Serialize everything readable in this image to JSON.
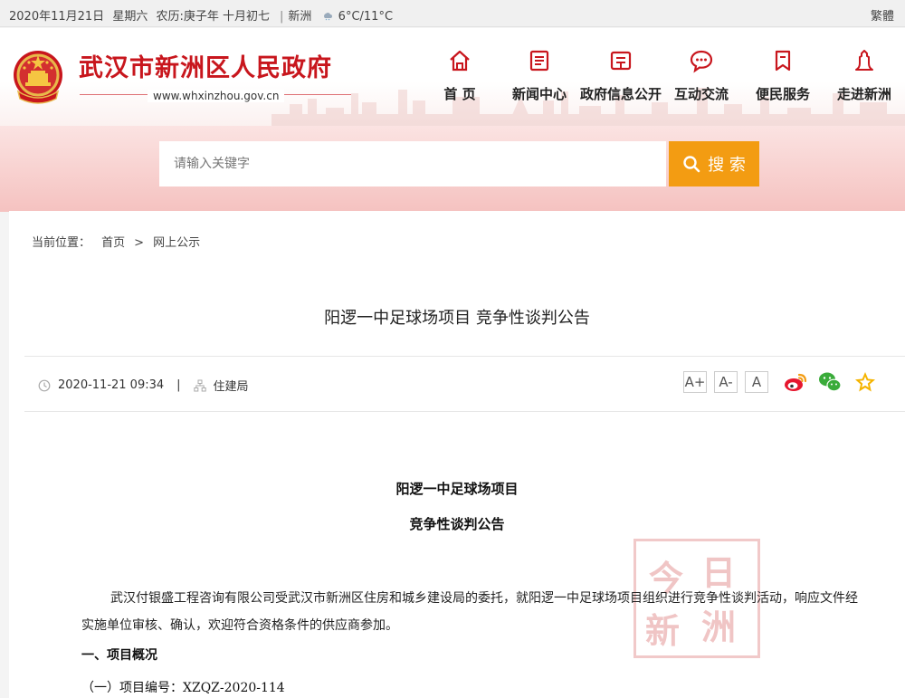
{
  "topbar": {
    "date": "2020年11月21日",
    "weekday": "星期六",
    "lunar": "农历:庚子年 十月初七",
    "city": "新洲",
    "temperature": "6°C/11°C",
    "traditional_label": "繁體"
  },
  "header": {
    "site_title": "武汉市新洲区人民政府",
    "site_url": "www.whxinzhou.gov.cn",
    "nav": [
      {
        "label": "首 页",
        "icon": "home-icon"
      },
      {
        "label": "新闻中心",
        "icon": "news-icon"
      },
      {
        "label": "政府信息公开",
        "icon": "info-icon"
      },
      {
        "label": "互动交流",
        "icon": "chat-icon"
      },
      {
        "label": "便民服务",
        "icon": "bookmark-icon"
      },
      {
        "label": "走进新洲",
        "icon": "landmark-icon"
      }
    ]
  },
  "search": {
    "placeholder": "请输入关键字",
    "button_label": "搜 索"
  },
  "breadcrumb": {
    "prefix": "当前位置：",
    "home": "首页",
    "separator": ">",
    "current": "网上公示"
  },
  "article": {
    "title": "阳逻一中足球场项目 竞争性谈判公告",
    "datetime": "2020-11-21 09:34",
    "meta_sep": "|",
    "source": "住建局",
    "font_sizes": [
      "A+",
      "A-",
      "A"
    ],
    "share": [
      "weibo-icon",
      "wechat-icon",
      "favorite-icon"
    ],
    "doc_title_1": "阳逻一中足球场项目",
    "doc_title_2": "竞争性谈判公告",
    "paragraph": "武汉付银盛工程咨询有限公司受武汉市新洲区住房和城乡建设局的委托，就阳逻一中足球场项目组织进行竞争性谈判活动，响应文件经实施单位审核、确认，欢迎符合资格条件的供应商参加。",
    "section_1": "一、项目概况",
    "item_1": "（一）项目编号：XZQZ-2020-114",
    "stamp": [
      "今",
      "日",
      "新",
      "洲"
    ]
  },
  "colors": {
    "brand_red": "#c8161d",
    "search_orange": "#f39c12"
  }
}
